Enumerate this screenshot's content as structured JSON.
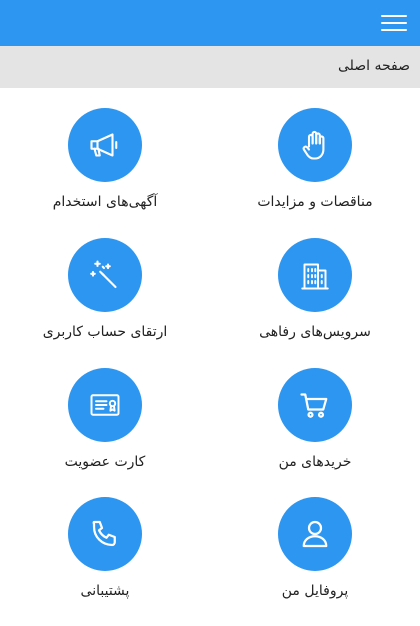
{
  "header": {
    "menu_icon": "hamburger-icon",
    "accent_color": "#2d96f0"
  },
  "breadcrumb": {
    "title": "صفحه اصلی"
  },
  "tiles": [
    {
      "label": "مناقصات و مزایدات",
      "icon": "raised-hand-icon"
    },
    {
      "label": "آگهی‌های استخدام",
      "icon": "megaphone-icon"
    },
    {
      "label": "سرویس‌های رفاهی",
      "icon": "building-icon"
    },
    {
      "label": "ارتقای حساب کاربری",
      "icon": "magic-wand-icon"
    },
    {
      "label": "خریدهای من",
      "icon": "shopping-cart-icon"
    },
    {
      "label": "کارت عضویت",
      "icon": "membership-card-icon"
    },
    {
      "label": "پروفایل من",
      "icon": "user-icon"
    },
    {
      "label": "پشتیبانی",
      "icon": "phone-icon"
    }
  ]
}
